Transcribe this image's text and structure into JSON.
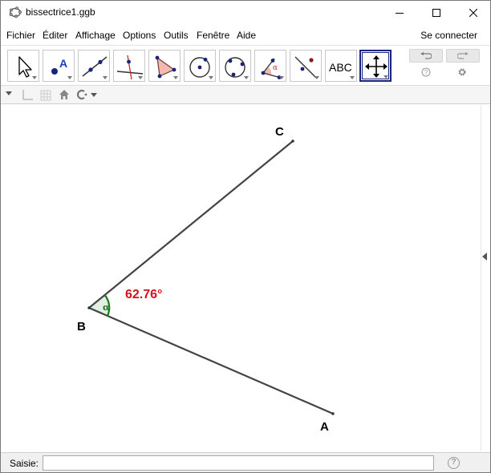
{
  "window": {
    "title": "bissectrice1.ggb"
  },
  "menu": {
    "items": [
      "Fichier",
      "Éditer",
      "Affichage",
      "Options",
      "Outils",
      "Fenêtre",
      "Aide"
    ],
    "signin": "Se connecter"
  },
  "toolbar": {
    "tools": [
      {
        "icon": "move-arrow-icon"
      },
      {
        "icon": "point-icon",
        "label": "A"
      },
      {
        "icon": "line-icon"
      },
      {
        "icon": "perpendicular-line-icon"
      },
      {
        "icon": "polygon-icon"
      },
      {
        "icon": "circle-center-point-icon"
      },
      {
        "icon": "circle-three-points-icon"
      },
      {
        "icon": "angle-icon",
        "label": "α"
      },
      {
        "icon": "reflect-icon"
      },
      {
        "icon": "text-icon",
        "label": "ABC"
      },
      {
        "icon": "move-graphics-view-icon",
        "selected": true
      }
    ]
  },
  "graphics": {
    "points": [
      {
        "name": "A",
        "label": "A"
      },
      {
        "name": "B",
        "label": "B"
      },
      {
        "name": "C",
        "label": "C"
      }
    ],
    "angle": {
      "symbol": "α",
      "value_label": "62.76°"
    },
    "colors": {
      "segment": "#444444",
      "angle": "#1b7a1b",
      "angle_value": "#d3121b"
    }
  },
  "input": {
    "label": "Saisie:",
    "value": "",
    "help": "?"
  }
}
